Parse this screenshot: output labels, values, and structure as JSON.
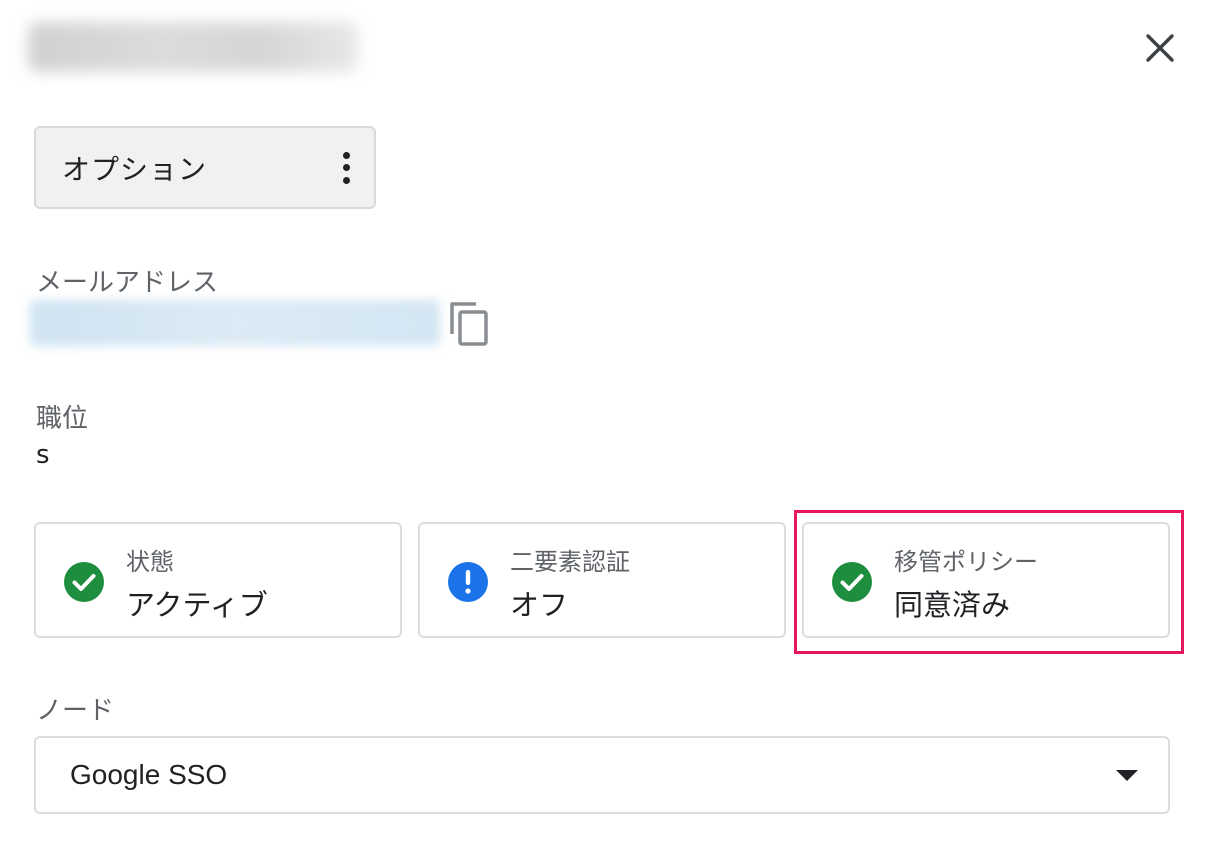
{
  "header": {
    "close_icon": "close-icon"
  },
  "options": {
    "label": "オプション",
    "menu_icon": "more-vert-icon"
  },
  "email": {
    "label": "メールアドレス",
    "copy_icon": "copy-icon"
  },
  "job_title": {
    "label": "職位",
    "value": "s"
  },
  "status_cards": [
    {
      "title": "状態",
      "value": "アクティブ",
      "icon": "check-circle-icon",
      "color": "#1e8e3e"
    },
    {
      "title": "二要素認証",
      "value": "オフ",
      "icon": "info-alert-icon",
      "color": "#1a73e8"
    },
    {
      "title": "移管ポリシー",
      "value": "同意済み",
      "icon": "check-circle-icon",
      "color": "#1e8e3e"
    }
  ],
  "node": {
    "label": "ノード",
    "selected": "Google SSO",
    "dropdown_icon": "caret-down-icon"
  },
  "colors": {
    "highlight": "#e8175d",
    "success": "#1e8e3e",
    "info": "#1a73e8"
  }
}
